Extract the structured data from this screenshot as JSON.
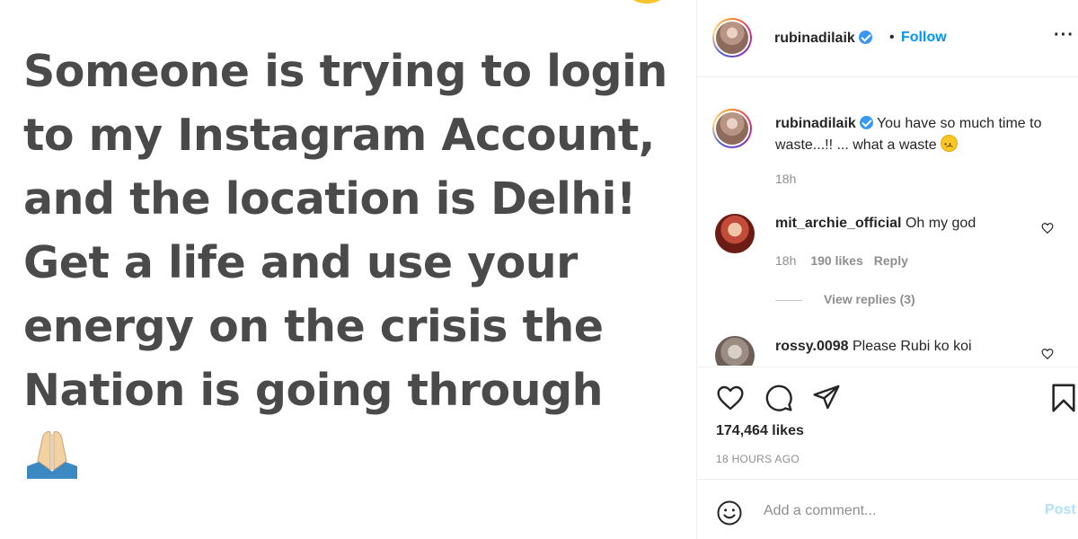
{
  "post": {
    "text_lines": [
      "Someone is trying to login",
      "to my Instagram Account,",
      "and the location is Delhi!",
      "Get a life and use your",
      "energy  on the crisis the",
      "Nation is going through"
    ],
    "emoji": "folded-hands"
  },
  "header": {
    "username": "rubinadilaik",
    "dot": "•",
    "follow_label": "Follow",
    "more_label": "···"
  },
  "caption": {
    "username": "rubinadilaik",
    "text": "You have so much time to waste...!! ... what a waste",
    "time": "18h"
  },
  "comments": [
    {
      "username": "mit_archie_official",
      "text": "Oh my god",
      "time": "18h",
      "likes": "190 likes",
      "reply_label": "Reply",
      "view_replies": "View replies (3)"
    },
    {
      "username": "rossy.0098",
      "text": "Please Rubi ko koi"
    }
  ],
  "actions": {
    "likes": "174,464 likes",
    "timestamp": "18 HOURS AGO"
  },
  "comment_box": {
    "placeholder": "Add a comment...",
    "post_label": "Post"
  },
  "colors": {
    "link_blue": "#0095f6",
    "verified_blue": "#3897f0",
    "muted": "#8e8e8e",
    "post_text": "#4a4a4a"
  }
}
